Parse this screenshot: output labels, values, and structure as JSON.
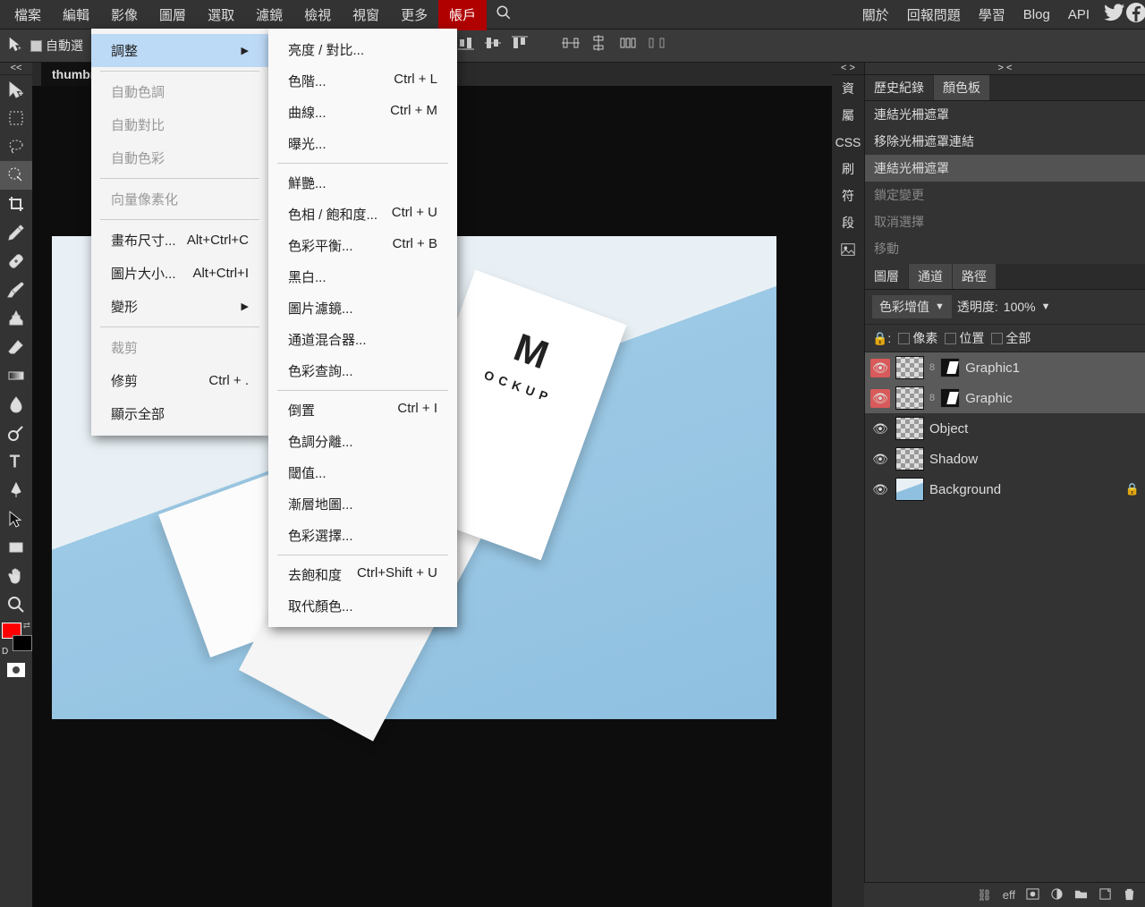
{
  "menu": {
    "file": "檔案",
    "edit": "編輯",
    "image": "影像",
    "layer": "圖層",
    "select": "選取",
    "filter": "濾鏡",
    "view": "檢視",
    "window": "視窗",
    "more": "更多",
    "account": "帳戶"
  },
  "rmenu": {
    "about": "關於",
    "report": "回報問題",
    "learn": "學習",
    "blog": "Blog",
    "api": "API"
  },
  "optionbar": {
    "autoselect": "自動選"
  },
  "tab": "thumbn",
  "dropdown1": {
    "adjustments": "調整",
    "autotone": "自動色調",
    "autocontrast": "自動對比",
    "autocolor": "自動色彩",
    "vectorize": "向量像素化",
    "canvassize": "畫布尺寸...",
    "canvassize_sc": "Alt+Ctrl+C",
    "imagesize": "圖片大小...",
    "imagesize_sc": "Alt+Ctrl+I",
    "transform": "變形",
    "crop": "裁剪",
    "trim": "修剪",
    "trim_sc": "Ctrl + .",
    "revealall": "顯示全部"
  },
  "dropdown2": {
    "brightness": "亮度 / 對比...",
    "levels": "色階...",
    "levels_sc": "Ctrl + L",
    "curves": "曲線...",
    "curves_sc": "Ctrl + M",
    "exposure": "曝光...",
    "vibrance": "鮮艷...",
    "huesat": "色相 / 飽和度...",
    "huesat_sc": "Ctrl + U",
    "colorbal": "色彩平衡...",
    "colorbal_sc": "Ctrl + B",
    "bw": "黑白...",
    "photofilter": "圖片濾鏡...",
    "chmixer": "通道混合器...",
    "colorlookup": "色彩查詢...",
    "invert": "倒置",
    "invert_sc": "Ctrl + I",
    "posterize": "色調分離...",
    "threshold": "閾值...",
    "gradmap": "漸層地圖...",
    "selcolor": "色彩選擇...",
    "desat": "去飽和度",
    "desat_sc": "Ctrl+Shift + U",
    "replace": "取代顏色..."
  },
  "sidetabs": {
    "info": "資",
    "prop": "屬",
    "css": "CSS",
    "brush": "刷",
    "char": "符",
    "para": "段"
  },
  "panel_tabs1": {
    "history": "歷史紀錄",
    "color": "顏色板"
  },
  "history": {
    "i0": "連結光柵遮罩",
    "i1": "移除光柵遮罩連結",
    "i2": "連結光柵遮罩",
    "i3": "鎖定變更",
    "i4": "取消選擇",
    "i5": "移動"
  },
  "panel_tabs2": {
    "layers": "圖層",
    "channels": "通道",
    "paths": "路徑"
  },
  "layer_opts": {
    "blend": "色彩增值",
    "opacity_label": "透明度:",
    "opacity_val": "100%"
  },
  "layer_locks": {
    "pixels": "像素",
    "position": "位置",
    "all": "全部"
  },
  "layers": {
    "l0": "Graphic1",
    "l1": "Graphic",
    "l2": "Object",
    "l3": "Shadow",
    "l4": "Background"
  },
  "footer": {
    "eff": "eff"
  }
}
